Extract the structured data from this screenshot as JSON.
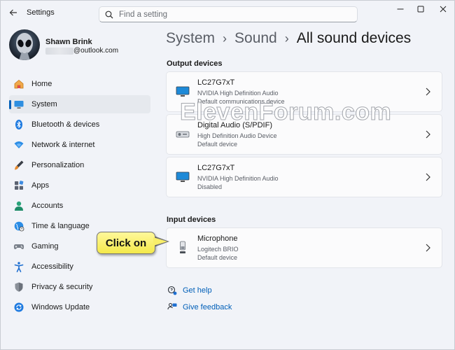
{
  "window": {
    "title": "Settings"
  },
  "search": {
    "placeholder": "Find a setting"
  },
  "profile": {
    "name": "Shawn Brink",
    "email_suffix": "@outlook.com"
  },
  "nav": {
    "items": [
      {
        "label": "Home",
        "icon": "home-icon"
      },
      {
        "label": "System",
        "icon": "system-icon",
        "active": true
      },
      {
        "label": "Bluetooth & devices",
        "icon": "bluetooth-icon"
      },
      {
        "label": "Network & internet",
        "icon": "wifi-icon"
      },
      {
        "label": "Personalization",
        "icon": "brush-icon"
      },
      {
        "label": "Apps",
        "icon": "apps-icon"
      },
      {
        "label": "Accounts",
        "icon": "accounts-icon"
      },
      {
        "label": "Time & language",
        "icon": "globe-icon"
      },
      {
        "label": "Gaming",
        "icon": "gamepad-icon"
      },
      {
        "label": "Accessibility",
        "icon": "accessibility-icon"
      },
      {
        "label": "Privacy & security",
        "icon": "shield-icon"
      },
      {
        "label": "Windows Update",
        "icon": "update-icon"
      }
    ]
  },
  "breadcrumb": {
    "part1": "System",
    "part2": "Sound",
    "current": "All sound devices",
    "separator": "›"
  },
  "output": {
    "title": "Output devices",
    "devices": [
      {
        "name": "LC27G7xT",
        "driver": "NVIDIA High Definition Audio",
        "status": "Default communications device",
        "icon": "monitor-icon"
      },
      {
        "name": "Digital Audio (S/PDIF)",
        "driver": "High Definition Audio Device",
        "status": "Default device",
        "icon": "speaker-box-icon"
      },
      {
        "name": "LC27G7xT",
        "driver": "NVIDIA High Definition Audio",
        "status": "Disabled",
        "icon": "monitor-icon"
      }
    ]
  },
  "input": {
    "title": "Input devices",
    "devices": [
      {
        "name": "Microphone",
        "driver": "Logitech BRIO",
        "status": "Default device",
        "icon": "microphone-icon"
      }
    ]
  },
  "links": {
    "help": "Get help",
    "feedback": "Give feedback"
  },
  "watermark": "ElevenForum.com",
  "callout": "Click on",
  "colors": {
    "accent": "#005fb8",
    "callout_fill": "#f8ee6a"
  }
}
